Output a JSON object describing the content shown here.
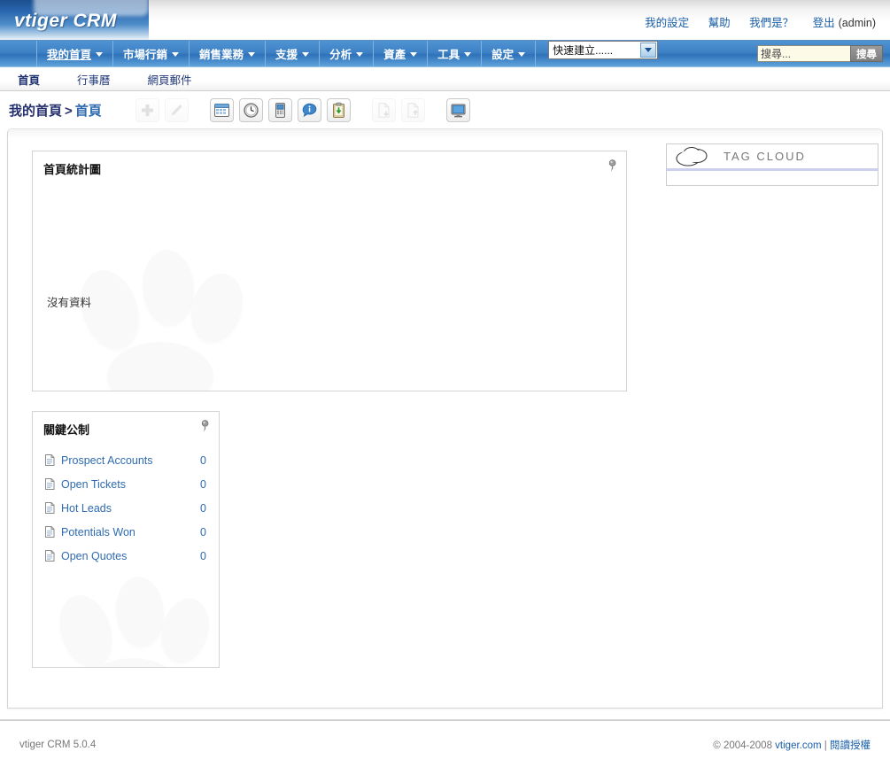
{
  "header": {
    "logo": "vtiger CRM",
    "links": [
      {
        "label": "我的設定",
        "name": "my-settings-link"
      },
      {
        "label": "幫助",
        "name": "help-link"
      },
      {
        "label": "我們是？",
        "name": "about-us-link"
      },
      {
        "label": "登出",
        "name": "logout-link"
      }
    ],
    "user": "(admin)"
  },
  "menubar": {
    "items": [
      {
        "label": "我的首頁",
        "active": true
      },
      {
        "label": "市場行銷",
        "active": false
      },
      {
        "label": "銷售業務",
        "active": false
      },
      {
        "label": "支援",
        "active": false
      },
      {
        "label": "分析",
        "active": false
      },
      {
        "label": "資產",
        "active": false
      },
      {
        "label": "工具",
        "active": false
      },
      {
        "label": "設定",
        "active": false
      }
    ],
    "quick_create_value": "快速建立......",
    "search_placeholder": "搜尋...",
    "search_value": "搜尋...",
    "search_button": "搜尋"
  },
  "subnav": {
    "items": [
      {
        "label": "首頁",
        "active": true
      },
      {
        "label": "行事曆",
        "active": false
      },
      {
        "label": "網頁郵件",
        "active": false
      }
    ]
  },
  "breadcrumb": {
    "parent": "我的首頁",
    "separator": ">",
    "current": "首頁"
  },
  "toolbar": {
    "buttons": [
      {
        "name": "add-icon",
        "enabled": false
      },
      {
        "name": "edit-pencil-icon",
        "enabled": false
      },
      {
        "name": "calendar-icon",
        "enabled": true
      },
      {
        "name": "clock-icon",
        "enabled": true
      },
      {
        "name": "device-icon",
        "enabled": true
      },
      {
        "name": "chat-bubble-icon",
        "enabled": true
      },
      {
        "name": "clipboard-icon",
        "enabled": true
      },
      {
        "name": "import-document-icon",
        "enabled": false
      },
      {
        "name": "export-document-icon",
        "enabled": false
      },
      {
        "name": "monitor-icon",
        "enabled": true
      }
    ]
  },
  "chart_panel": {
    "title": "首頁統計圖",
    "empty_text": "沒有資料"
  },
  "metrics_panel": {
    "title": "關鍵公制",
    "rows": [
      {
        "label": "Prospect Accounts",
        "value": "0"
      },
      {
        "label": "Open Tickets",
        "value": "0"
      },
      {
        "label": "Hot Leads",
        "value": "0"
      },
      {
        "label": "Potentials Won",
        "value": "0"
      },
      {
        "label": "Open Quotes",
        "value": "0"
      }
    ]
  },
  "tag_cloud": {
    "title": "TAG  CLOUD"
  },
  "footer": {
    "version": "vtiger CRM 5.0.4",
    "copyright": "© 2004-2008",
    "site": "vtiger.com",
    "divider": "|",
    "license": "閱讀授權"
  },
  "colors": {
    "menu_blue": "#3e82c6",
    "link_blue": "#2f6bb0",
    "crumb_navy": "#25316e",
    "logo_blue": "#2a66ad"
  }
}
